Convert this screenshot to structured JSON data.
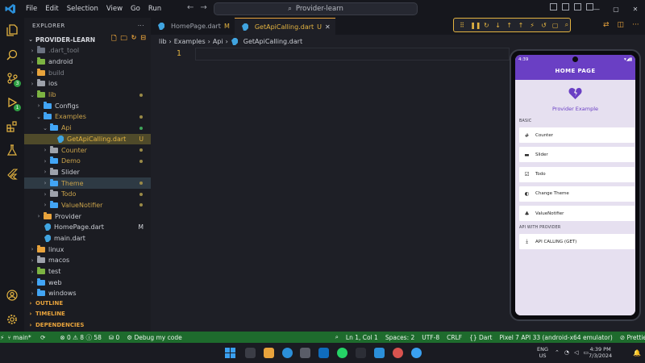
{
  "menu": [
    "File",
    "Edit",
    "Selection",
    "View",
    "Go",
    "Run"
  ],
  "title_bar": {
    "search_text": "Provider-learn",
    "minimize": "—",
    "maximize": "▢",
    "close": "✕"
  },
  "sidebar": {
    "header": "EXPLORER",
    "more": "···",
    "project": "PROVIDER-LEARN",
    "tree": [
      {
        "label": ".dart_tool",
        "depth": 1,
        "kind": "folder",
        "color": "#6b7280",
        "chev": "›",
        "dim": true
      },
      {
        "label": "android",
        "depth": 1,
        "kind": "folder",
        "color": "#7cb342",
        "chev": "›"
      },
      {
        "label": "build",
        "depth": 1,
        "kind": "folder",
        "color": "#e8a33c",
        "chev": "›",
        "dim": true
      },
      {
        "label": "ios",
        "depth": 1,
        "kind": "folder",
        "color": "#9ea2ab",
        "chev": "›"
      },
      {
        "label": "lib",
        "depth": 1,
        "kind": "folder",
        "color": "#7cb342",
        "chev": "⌄",
        "dot": true,
        "text_color": "#c9a24a"
      },
      {
        "label": "Configs",
        "depth": 2,
        "kind": "folder",
        "color": "#42a5f5",
        "chev": "›"
      },
      {
        "label": "Examples",
        "depth": 2,
        "kind": "folder",
        "color": "#42a5f5",
        "chev": "⌄",
        "dot": true,
        "text_color": "#c9a24a"
      },
      {
        "label": "Api",
        "depth": 3,
        "kind": "folder",
        "color": "#42a5f5",
        "chev": "⌄",
        "dot": true,
        "text_color": "#c9a24a",
        "dot_color": "#3fa55a"
      },
      {
        "label": "GetApiCalling.dart",
        "depth": 4,
        "kind": "dart",
        "status": "U",
        "selected": true,
        "text_color": "#e3b341"
      },
      {
        "label": "Counter",
        "depth": 3,
        "kind": "folder",
        "color": "#9ea2ab",
        "chev": "›",
        "dot": true,
        "text_color": "#c9a24a"
      },
      {
        "label": "Demo",
        "depth": 3,
        "kind": "folder",
        "color": "#42a5f5",
        "chev": "›",
        "dot": true,
        "text_color": "#c9a24a"
      },
      {
        "label": "Slider",
        "depth": 3,
        "kind": "folder",
        "color": "#9ea2ab",
        "chev": "›"
      },
      {
        "label": "Theme",
        "depth": 3,
        "kind": "folder",
        "color": "#42a5f5",
        "chev": "›",
        "dot": true,
        "hover": true,
        "text_color": "#c9a24a"
      },
      {
        "label": "Todo",
        "depth": 3,
        "kind": "folder",
        "color": "#9ea2ab",
        "chev": "›",
        "dot": true,
        "text_color": "#c9a24a"
      },
      {
        "label": "ValueNotifier",
        "depth": 3,
        "kind": "folder",
        "color": "#42a5f5",
        "chev": "›",
        "dot": true,
        "text_color": "#c9a24a"
      },
      {
        "label": "Provider",
        "depth": 2,
        "kind": "folder",
        "color": "#e8a33c",
        "chev": "›"
      },
      {
        "label": "HomePage.dart",
        "depth": 2,
        "kind": "dart",
        "status": "M",
        "status_color": "#d8dae0"
      },
      {
        "label": "main.dart",
        "depth": 2,
        "kind": "dart"
      },
      {
        "label": "linux",
        "depth": 1,
        "kind": "folder",
        "color": "#e8a33c",
        "chev": "›"
      },
      {
        "label": "macos",
        "depth": 1,
        "kind": "folder",
        "color": "#9ea2ab",
        "chev": "›"
      },
      {
        "label": "test",
        "depth": 1,
        "kind": "folder",
        "color": "#7cb342",
        "chev": "›"
      },
      {
        "label": "web",
        "depth": 1,
        "kind": "folder",
        "color": "#42a5f5",
        "chev": "›"
      },
      {
        "label": "windows",
        "depth": 1,
        "kind": "folder",
        "color": "#42a5f5",
        "chev": "›"
      }
    ],
    "sections": [
      "OUTLINE",
      "TIMELINE",
      "DEPENDENCIES"
    ]
  },
  "tabs": [
    {
      "label": "HomePage.dart",
      "status": "M",
      "active": false
    },
    {
      "label": "GetApiCalling.dart",
      "status": "U",
      "active": true,
      "close": "✕"
    }
  ],
  "breadcrumb": [
    "lib",
    "Examples",
    "Api",
    "GetApiCalling.dart"
  ],
  "editor": {
    "line_number": "1"
  },
  "debug_toolbar": [
    "⠿",
    "❚❚",
    "↻",
    "↓",
    "↑",
    "↑",
    "⚡",
    "↺",
    "▢",
    "⌕"
  ],
  "phone": {
    "status_time": "4:39",
    "status_icons": "▾◢▮",
    "app_title": "HOME PAGE",
    "subtitle": "Provider Example",
    "section_basic": "BASIC",
    "basic_items": [
      {
        "label": "Counter",
        "icon": "#"
      },
      {
        "label": "Slider",
        "icon": "▬"
      },
      {
        "label": "Todo",
        "icon": "☑"
      },
      {
        "label": "Change Theme",
        "icon": "◐"
      },
      {
        "label": "ValueNotifier",
        "icon": "♣"
      }
    ],
    "section_api": "API WITH PROVIDER",
    "api_items": [
      {
        "label": "API CALLING (GET)",
        "icon": "⤓"
      }
    ]
  },
  "statusbar": {
    "branch": "main*",
    "sync": "⟳",
    "problems": "⊗ 0 ⚠ 8 ⓘ 58",
    "ports": "⛁ 0",
    "debug": "Debug my code",
    "cursor": "Ln 1, Col 1",
    "spaces": "Spaces: 2",
    "encoding": "UTF-8",
    "eol": "CRLF",
    "language": "{} Dart",
    "device": "Pixel 7 API 33 (android-x64 emulator)",
    "prettier": "⊘ Prettier"
  },
  "taskbar": {
    "lang_top": "ENG",
    "lang_bottom": "US",
    "time": "4:39 PM",
    "date": "7/3/2024"
  },
  "colors": {
    "accent": "#e3b341",
    "status_green": "#1e6b2d",
    "app_purple": "#6a3fc4",
    "heart": "#6a3fc4"
  }
}
